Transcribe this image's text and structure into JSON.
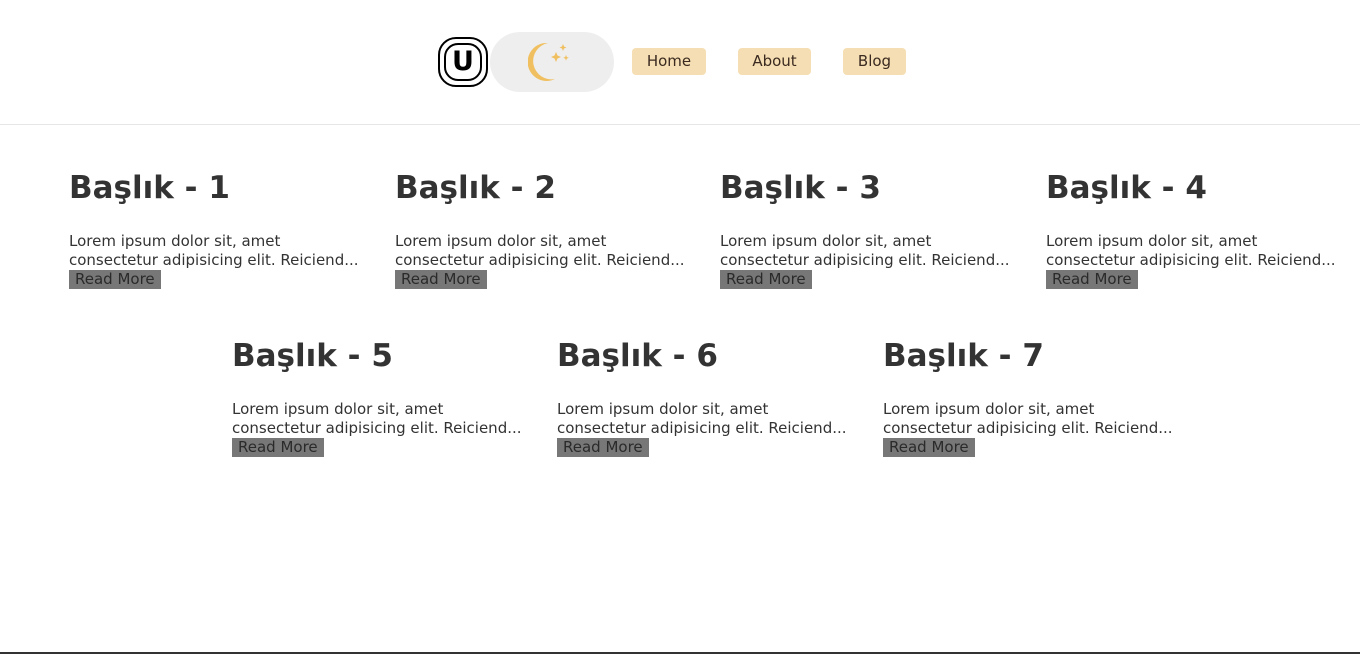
{
  "header": {
    "logo_letter": "U",
    "theme_toggle_icon": "moon-stars-icon",
    "nav": [
      {
        "label": "Home"
      },
      {
        "label": "About"
      },
      {
        "label": "Blog"
      }
    ]
  },
  "colors": {
    "nav_bg": "#f5deb3",
    "toggle_bg": "#eeeeee",
    "moon": "#f0c060",
    "read_more_bg": "#777777",
    "text": "#333333"
  },
  "posts": [
    {
      "title": "Başlık - 1",
      "excerpt": "Lorem ipsum dolor sit, amet consectetur adipisicing elit. Reiciend...",
      "link": "Read More"
    },
    {
      "title": "Başlık - 2",
      "excerpt": "Lorem ipsum dolor sit, amet consectetur adipisicing elit. Reiciend...",
      "link": "Read More"
    },
    {
      "title": "Başlık - 3",
      "excerpt": "Lorem ipsum dolor sit, amet consectetur adipisicing elit. Reiciend...",
      "link": "Read More"
    },
    {
      "title": "Başlık - 4",
      "excerpt": "Lorem ipsum dolor sit, amet consectetur adipisicing elit. Reiciend...",
      "link": "Read More"
    },
    {
      "title": "Başlık - 5",
      "excerpt": "Lorem ipsum dolor sit, amet consectetur adipisicing elit. Reiciend...",
      "link": "Read More"
    },
    {
      "title": "Başlık - 6",
      "excerpt": "Lorem ipsum dolor sit, amet consectetur adipisicing elit. Reiciend...",
      "link": "Read More"
    },
    {
      "title": "Başlık - 7",
      "excerpt": "Lorem ipsum dolor sit, amet consectetur adipisicing elit. Reiciend...",
      "link": "Read More"
    }
  ]
}
